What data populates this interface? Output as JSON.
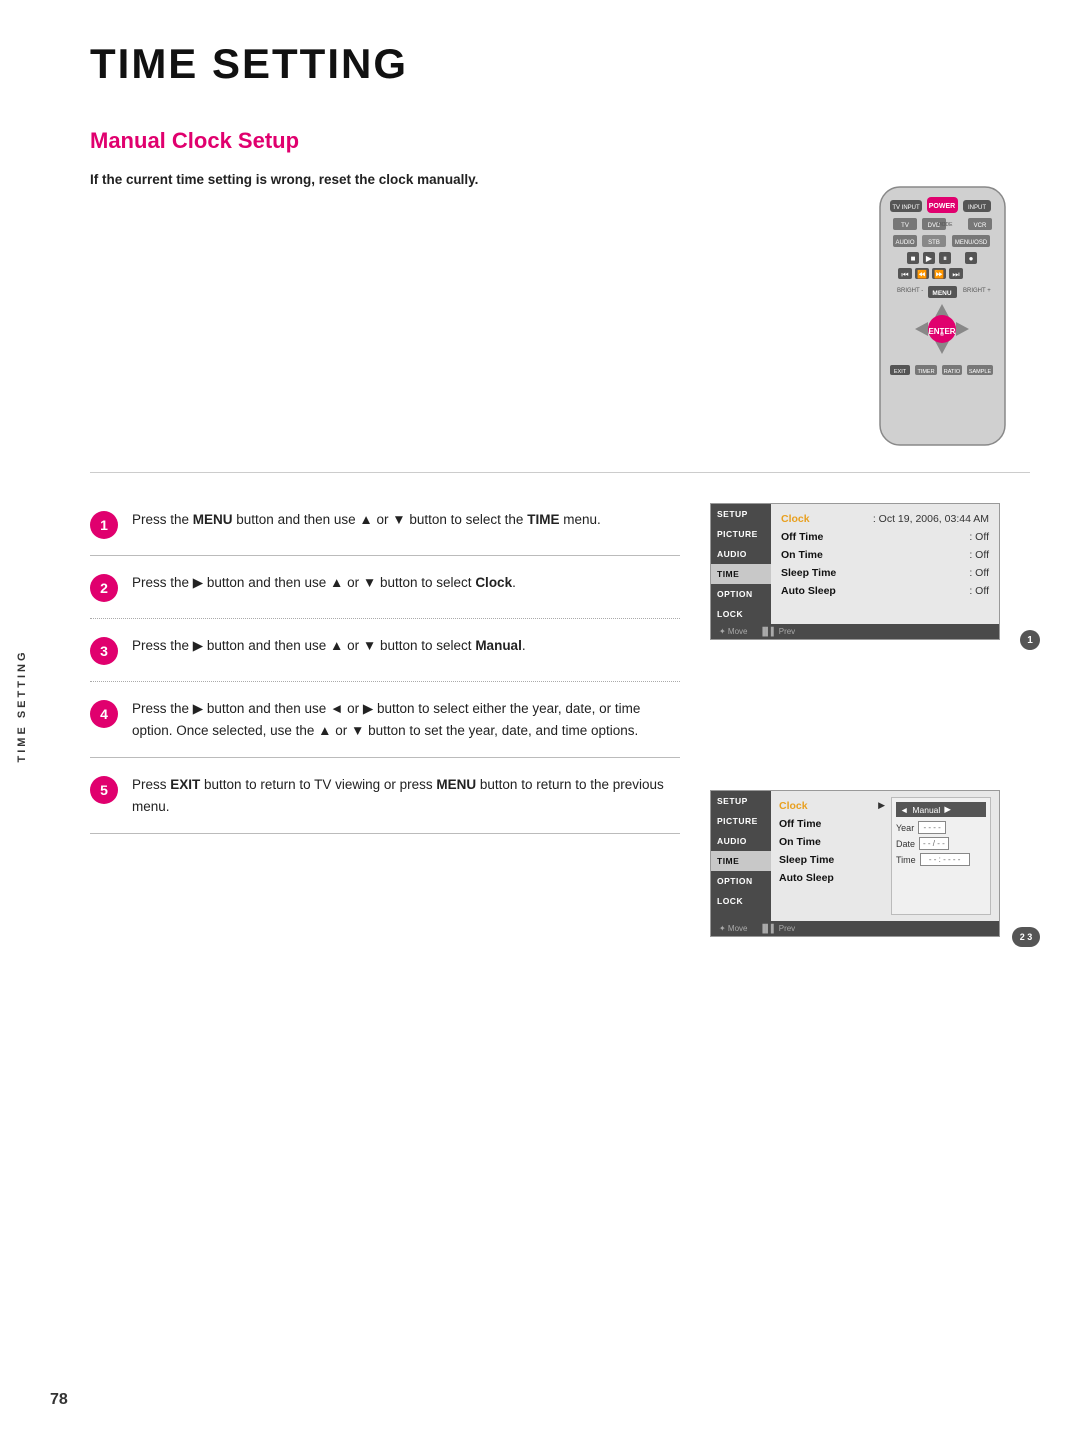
{
  "page": {
    "title": "TIME SETTING",
    "section_heading": "Manual Clock Setup",
    "intro": "If the current time setting is wrong, reset the clock manually.",
    "page_number": "78"
  },
  "side_label": "TIME SETTING",
  "steps": [
    {
      "number": "1",
      "text_parts": [
        {
          "type": "normal",
          "text": "Press the "
        },
        {
          "type": "bold",
          "text": "MENU"
        },
        {
          "type": "normal",
          "text": " button and then use ▲ or ▼ button to select the "
        },
        {
          "type": "bold",
          "text": "TIME"
        },
        {
          "type": "normal",
          "text": " menu."
        }
      ],
      "border": "solid"
    },
    {
      "number": "2",
      "text_parts": [
        {
          "type": "normal",
          "text": "Press the ▶ button and then use ▲ or ▼ button to select "
        },
        {
          "type": "bold",
          "text": "Clock"
        },
        {
          "type": "normal",
          "text": "."
        }
      ],
      "border": "dotted"
    },
    {
      "number": "3",
      "text_parts": [
        {
          "type": "normal",
          "text": "Press the ▶ button and then use ▲ or ▼ button to select "
        },
        {
          "type": "bold",
          "text": "Manual"
        },
        {
          "type": "normal",
          "text": "."
        }
      ],
      "border": "dotted"
    },
    {
      "number": "4",
      "text_parts": [
        {
          "type": "normal",
          "text": "Press the ▶ button and then use ◄ or ▶ button to select either the year, date, or time option. Once selected, use the ▲ or ▼ button to set the year, date, and time options."
        }
      ],
      "border": "solid"
    },
    {
      "number": "5",
      "text_parts": [
        {
          "type": "normal",
          "text": "Press "
        },
        {
          "type": "bold",
          "text": "EXIT"
        },
        {
          "type": "normal",
          "text": " button to return to TV viewing or press "
        },
        {
          "type": "bold",
          "text": "MENU"
        },
        {
          "type": "normal",
          "text": " button to return to the previous menu."
        }
      ],
      "border": "solid"
    }
  ],
  "menu1": {
    "sidebar_items": [
      "SETUP",
      "PICTURE",
      "AUDIO",
      "TIME",
      "OPTION",
      "LOCK"
    ],
    "active_item": "TIME",
    "rows": [
      {
        "label": "Clock",
        "value": ": Oct 19, 2006, 03:44 AM",
        "highlighted": true
      },
      {
        "label": "Off Time",
        "value": ": Off"
      },
      {
        "label": "On Time",
        "value": ": Off"
      },
      {
        "label": "Sleep Time",
        "value": ": Off"
      },
      {
        "label": "Auto Sleep",
        "value": ": Off"
      }
    ],
    "footer": "Move  ▐▌▌ Prev"
  },
  "menu2": {
    "sidebar_items": [
      "SETUP",
      "PICTURE",
      "AUDIO",
      "TIME",
      "OPTION",
      "LOCK"
    ],
    "active_item": "TIME",
    "rows": [
      {
        "label": "Clock",
        "arrow": true
      },
      {
        "label": "Off Time"
      },
      {
        "label": "On Time"
      },
      {
        "label": "Sleep Time"
      },
      {
        "label": "Auto Sleep"
      }
    ],
    "right_panel": {
      "title": "◄ Manual ▶",
      "fields": [
        {
          "label": "Year",
          "value": "- - - -"
        },
        {
          "label": "Date",
          "value": "- - / - -"
        },
        {
          "label": "Time",
          "value": "- - : - - - -"
        }
      ]
    },
    "footer": "Move  ▐▌▌ Prev"
  }
}
